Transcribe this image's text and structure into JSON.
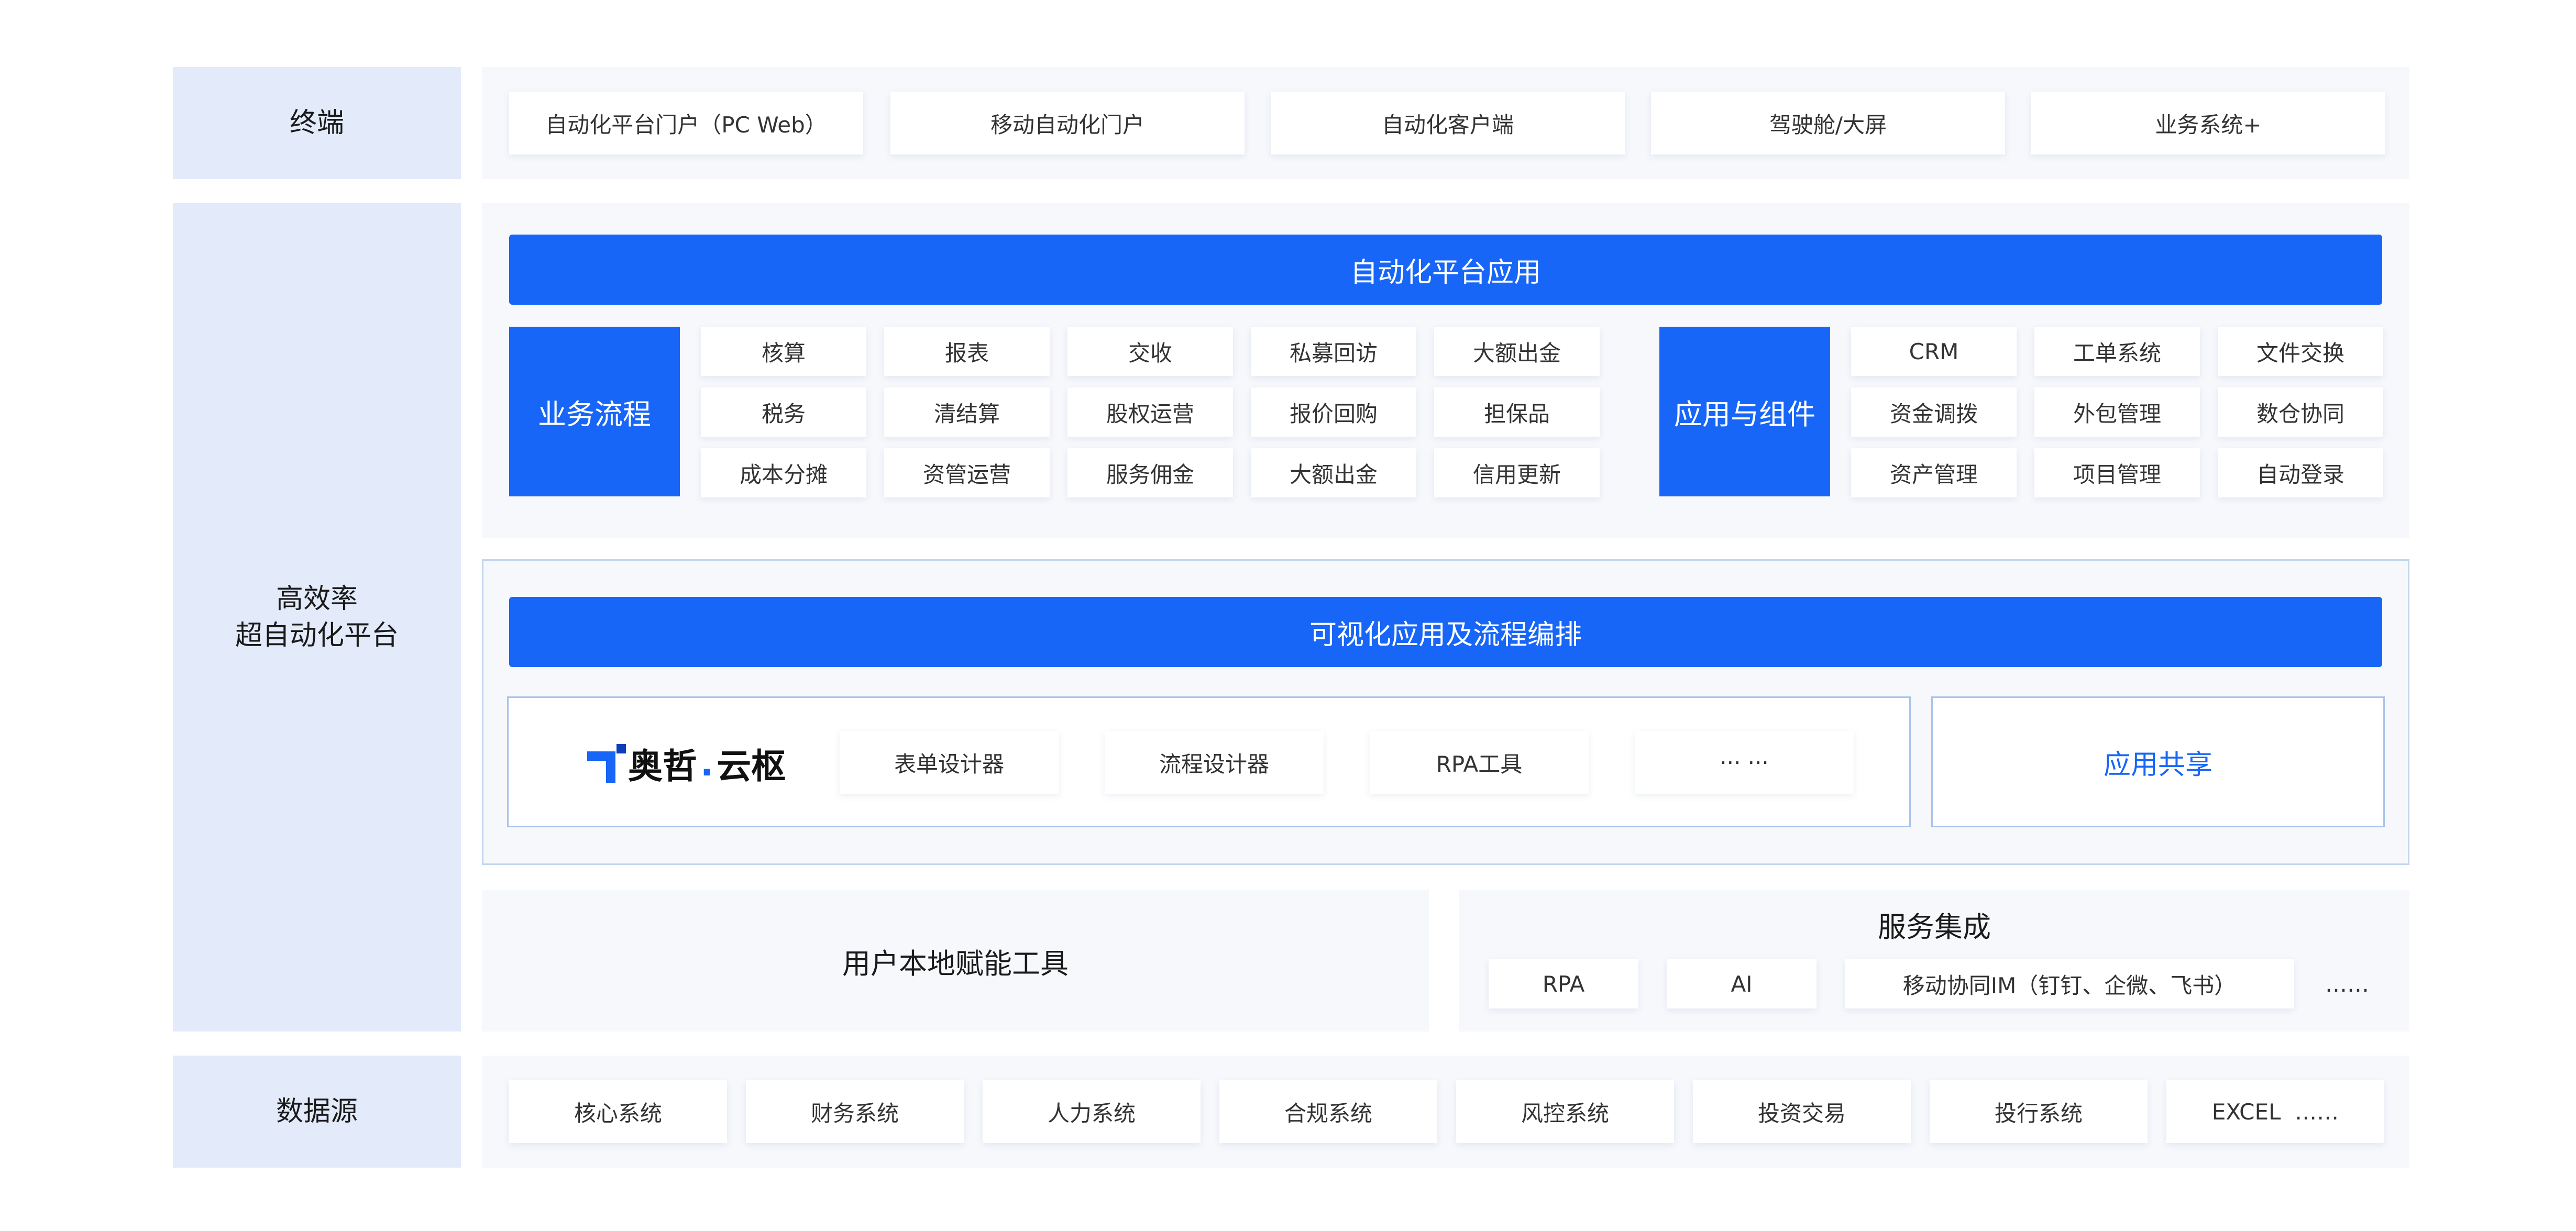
{
  "terminal": {
    "label": "终端",
    "items": [
      "自动化平台门户（PC Web）",
      "移动自动化门户",
      "自动化客户端",
      "驾驶舱/大屏",
      "业务系统+"
    ]
  },
  "platform": {
    "label_line1": "高效率",
    "label_line2": "超自动化平台",
    "apps": {
      "title": "自动化平台应用",
      "business_flow": {
        "label": "业务流程",
        "rows": [
          [
            "核算",
            "报表",
            "交收",
            "私募回访",
            "大额出金"
          ],
          [
            "税务",
            "清结算",
            "股权运营",
            "报价回购",
            "担保品"
          ],
          [
            "成本分摊",
            "资管运营",
            "服务佣金",
            "大额出金",
            "信用更新"
          ]
        ]
      },
      "components": {
        "label": "应用与组件",
        "rows": [
          [
            "CRM",
            "工单系统",
            "文件交换"
          ],
          [
            "资金调拨",
            "外包管理",
            "数仓协同"
          ],
          [
            "资产管理",
            "项目管理",
            "自动登录"
          ]
        ]
      }
    },
    "visual": {
      "title": "可视化应用及流程编排",
      "logo_text_a": "奥哲",
      "logo_dot": ".",
      "logo_text_b": "云枢",
      "tools": [
        "表单设计器",
        "流程设计器",
        "RPA工具",
        "··· ···"
      ],
      "share": "应用共享"
    },
    "local_tools": "用户本地赋能工具",
    "service": {
      "title": "服务集成",
      "items": [
        "RPA",
        "AI",
        "移动协同IM（钉钉、企微、飞书）"
      ],
      "more": "……"
    }
  },
  "datasource": {
    "label": "数据源",
    "items": [
      "核心系统",
      "财务系统",
      "人力系统",
      "合规系统",
      "风控系统",
      "投资交易",
      "投行系统",
      "EXCEL  ……"
    ]
  },
  "colors": {
    "accent_blue": "#1766f8",
    "label_bg": "#e3ebfb",
    "panel_bg": "#f6f8fc",
    "outline": "#a9c4ec"
  }
}
